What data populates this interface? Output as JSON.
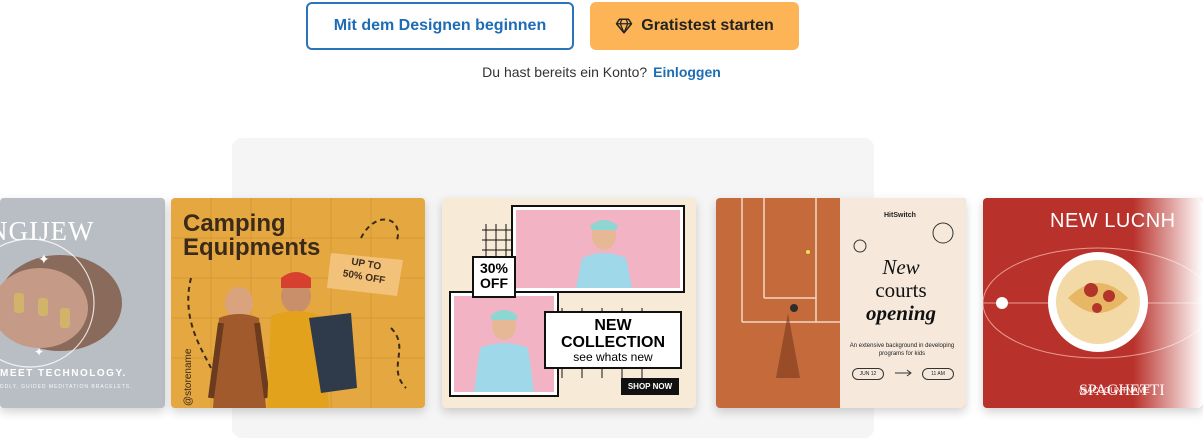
{
  "cta": {
    "design_label": "Mit dem Designen beginnen",
    "trial_label": "Gratistest starten",
    "trial_icon": "diamond-icon"
  },
  "login": {
    "prompt": "Du hast bereits ein Konto?",
    "link": "Einloggen"
  },
  "colors": {
    "primary": "#1d6db5",
    "accent": "#fdb456"
  },
  "templates": [
    {
      "title": "NGIJEW",
      "tagline": "MEET TECHNOLOGY.",
      "subline": "DDLY, GUIDED MEDITATION BRACELETS."
    },
    {
      "title": "Camping Equipments",
      "promo": "UP TO 50% OFF",
      "handle": "@storename"
    },
    {
      "discount": "30% OFF",
      "title_line1": "NEW",
      "title_line2": "COLLECTION",
      "subtitle": "see whats new",
      "shop": "SHOP NOW"
    },
    {
      "brand": "HitSwitch",
      "headline_1": "New",
      "headline_2": "courts",
      "headline_3": "opening",
      "description": "An extensive background in developing programs for kids",
      "date": "JUN 12",
      "time": "11 AM"
    },
    {
      "title": "NEW LUCNH",
      "dish": "SPAGHETTI",
      "account": "@ACCOUNTNAME"
    }
  ]
}
